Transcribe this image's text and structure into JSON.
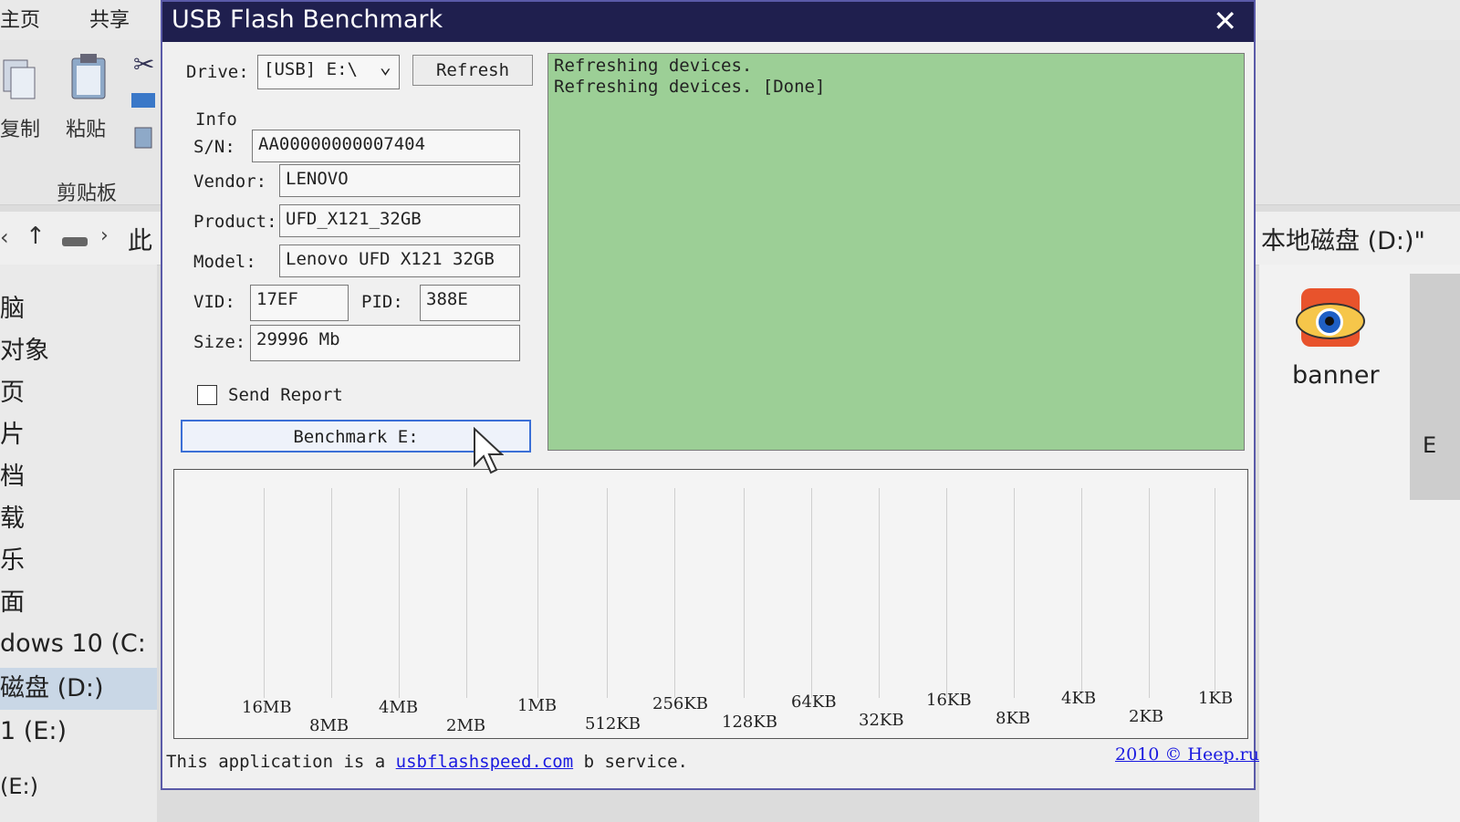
{
  "explorer": {
    "tabs": [
      "主页",
      "共享"
    ],
    "ribbon": {
      "copy_label": "复制",
      "paste_label": "粘贴",
      "group_label": "剪贴板"
    },
    "address": {
      "crumb": "此",
      "right_title": "本地磁盘 (D:)\""
    },
    "nav_items": [
      "脑",
      "对象",
      "页",
      "片",
      "档",
      "载",
      "乐",
      "面",
      "dows 10 (C:",
      "磁盘 (D:)",
      "1 (E:)",
      "(E:)"
    ],
    "desktop_icon_label": "banner",
    "right_edge_letter": "E"
  },
  "window": {
    "title": "USB Flash Benchmark",
    "close_glyph": "✕",
    "drive": {
      "label": "Drive:",
      "value": "[USB] E:\\",
      "arrow": "⌄"
    },
    "refresh_label": "Refresh",
    "info": {
      "heading": "Info",
      "sn_label": "S/N:",
      "sn_value": "AA00000000007404",
      "vendor_label": "Vendor:",
      "vendor_value": "LENOVO",
      "product_label": "Product:",
      "product_value": "UFD_X121_32GB",
      "model_label": "Model:",
      "model_value": "Lenovo UFD X121 32GB",
      "vid_label": "VID:",
      "vid_value": "17EF",
      "pid_label": "PID:",
      "pid_value": "388E",
      "size_label": "Size:",
      "size_value": "29996 Mb"
    },
    "send_report_label": "Send Report",
    "send_report_checked": false,
    "benchmark_label": "Benchmark E:",
    "log_lines": [
      "Refreshing devices.",
      "Refreshing devices. [Done]"
    ],
    "chart_ticks_top": [
      "16MB",
      "4MB",
      "1MB",
      "256KB",
      "64KB",
      "16KB",
      "4KB",
      "1KB"
    ],
    "chart_ticks_bottom": [
      "8MB",
      "2MB",
      "512KB",
      "128KB",
      "32KB",
      "8KB",
      "2KB"
    ],
    "footer": {
      "prefix": "This application is a ",
      "link": "usbflashspeed.com",
      "suffix": " b service."
    },
    "copyright": "2010 © Heep.ru"
  }
}
